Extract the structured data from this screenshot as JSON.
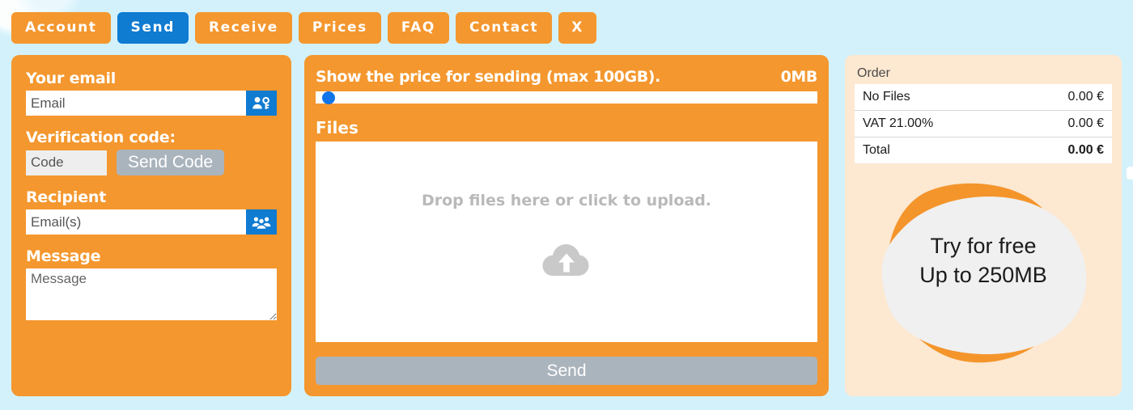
{
  "theme": {
    "page_bg": "#d3f1fb",
    "panel_orange": "#f4972e",
    "panel_peach": "#fde8d1",
    "accent_blue": "#0f7bd1",
    "muted_gray": "#aab4bd"
  },
  "nav": {
    "items": [
      {
        "label": "Account",
        "active": false
      },
      {
        "label": "Send",
        "active": true
      },
      {
        "label": "Receive",
        "active": false
      },
      {
        "label": "Prices",
        "active": false
      },
      {
        "label": "FAQ",
        "active": false
      },
      {
        "label": "Contact",
        "active": false
      },
      {
        "label": "X",
        "active": false
      }
    ]
  },
  "form": {
    "email": {
      "label": "Your email",
      "placeholder": "Email",
      "value": "",
      "icon": "user-key-icon"
    },
    "verification": {
      "label": "Verification code:",
      "placeholder": "Code",
      "value": "",
      "button_label": "Send Code"
    },
    "recipient": {
      "label": "Recipient",
      "placeholder": "Email(s)",
      "value": "",
      "icon": "user-group-icon"
    },
    "message": {
      "label": "Message",
      "placeholder": "Message",
      "value": ""
    }
  },
  "uploader": {
    "price_title": "Show the price for sending (max 100GB).",
    "size_readout": "0MB",
    "slider": {
      "value": 0,
      "min": 0,
      "max": 100,
      "unit": "GB"
    },
    "files_label": "Files",
    "dropzone_text": "Drop files here or click to upload.",
    "dropzone_icon": "cloud-upload-icon",
    "send_label": "Send"
  },
  "order": {
    "title": "Order",
    "rows": [
      {
        "label": "No Files",
        "amount": "0.00 €",
        "emphasis": false
      },
      {
        "label": "VAT 21.00%",
        "amount": "0.00 €",
        "emphasis": false
      },
      {
        "label": "Total",
        "amount": "0.00 €",
        "emphasis": true
      }
    ]
  },
  "promo": {
    "line1": "Try for free",
    "line2": "Up to 250MB",
    "blob_back_color": "#f4952c",
    "blob_front_color": "#f0f0f0"
  }
}
